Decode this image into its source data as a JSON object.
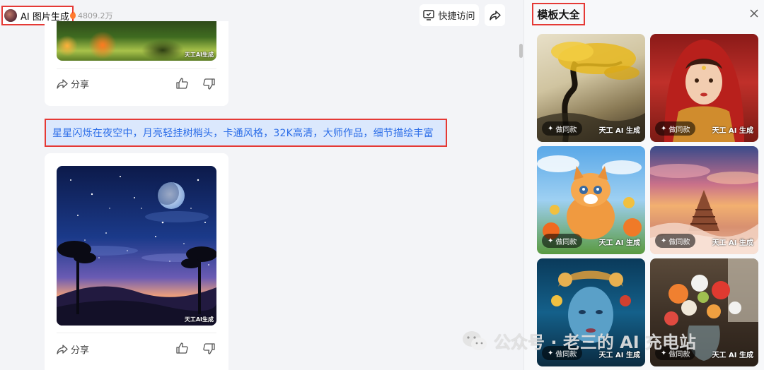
{
  "header": {
    "app_title": "AI 图片生成",
    "view_count": "4809.2万",
    "quick_access_label": "快捷访问"
  },
  "feed": {
    "first_card": {
      "image_watermark": "天工AI生成",
      "share_label": "分享"
    },
    "prompt_text": "星星闪烁在夜空中，月亮轻挂树梢头，卡通风格，32K高清，大师作品，细节描绘丰富",
    "second_card": {
      "image_watermark": "天工AI生成",
      "share_label": "分享"
    }
  },
  "panel": {
    "title": "模板大全",
    "templates": [
      {
        "make_label": "做同款",
        "watermark": "天工 AI 生成",
        "subject": "golden tree landscape"
      },
      {
        "make_label": "做同款",
        "watermark": "天工 AI 生成",
        "subject": "woman in red headdress"
      },
      {
        "make_label": "做同款",
        "watermark": "天工 AI 生成",
        "subject": "orange kitten with flowers"
      },
      {
        "make_label": "做同款",
        "watermark": "天工 AI 生成",
        "subject": "temple above clouds at sunset"
      },
      {
        "make_label": "做同款",
        "watermark": "天工 AI 生成",
        "subject": "woman with flower crown"
      },
      {
        "make_label": "做同款",
        "watermark": "天工 AI 生成",
        "subject": "flowers in glass vase"
      }
    ]
  },
  "page_watermark": "公众号 · 老三的 AI 充电站",
  "colors": {
    "highlight_border": "#e53935",
    "prompt_bg": "#dbe8fd",
    "prompt_text": "#2b6de8"
  }
}
